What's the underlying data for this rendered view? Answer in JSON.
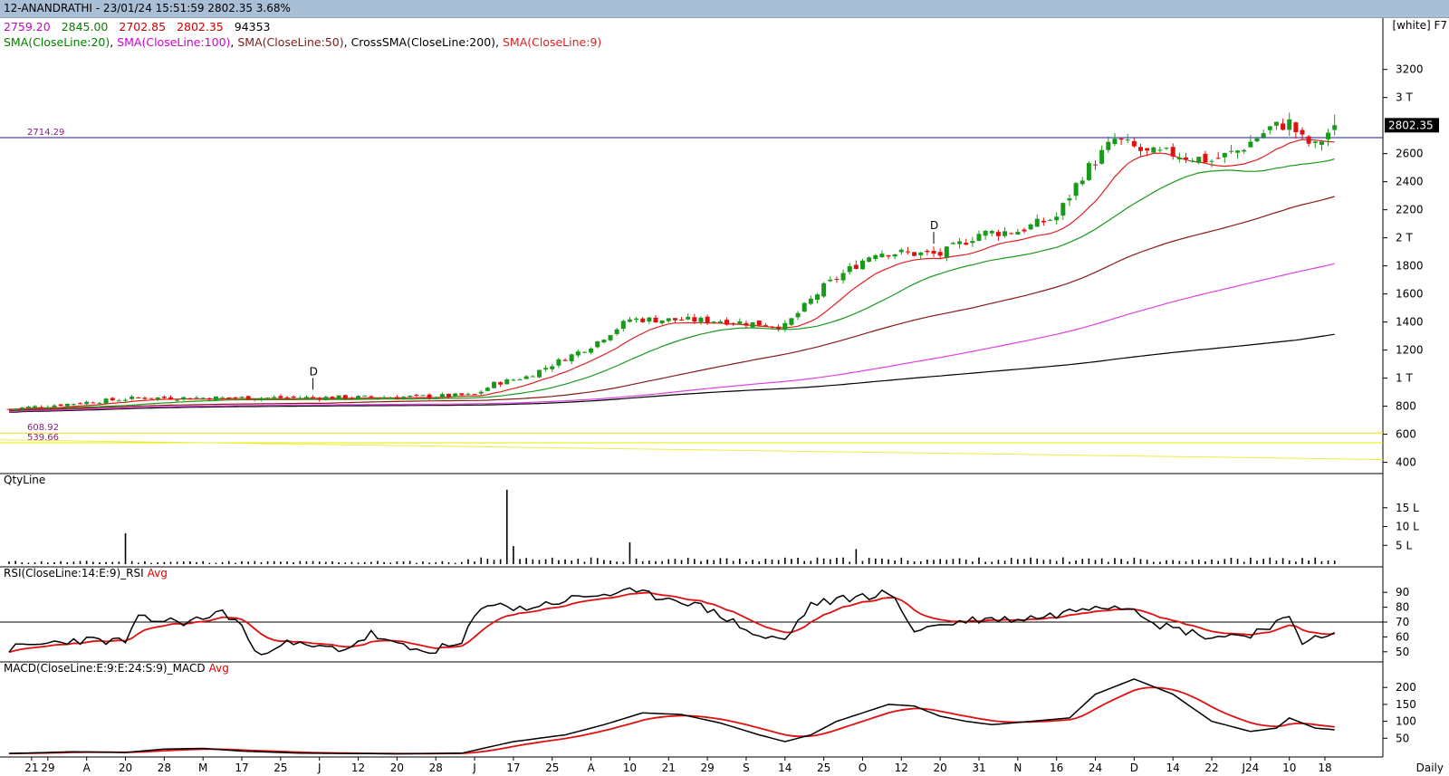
{
  "header": {
    "title": "12-ANANDRATHI - 23/01/24 15:51:59 2802.35 3.68%",
    "ohlc": [
      {
        "value": "2759.20",
        "color": "#cc00cc"
      },
      {
        "value": "2845.00",
        "color": "#008000"
      },
      {
        "value": "2702.85",
        "color": "#cc0000"
      },
      {
        "value": "2802.35",
        "color": "#cc0000"
      },
      {
        "value": "94353",
        "color": "#000000"
      }
    ],
    "indicators": [
      {
        "label": "SMA(CloseLine:20)",
        "color": "#008000"
      },
      {
        "label": "SMA(CloseLine:100)",
        "color": "#cc00cc"
      },
      {
        "label": "SMA(CloseLine:50)",
        "color": "#7a1a1a"
      },
      {
        "label": "CrossSMA(CloseLine:200)",
        "color": "#000000"
      },
      {
        "label": "SMA(CloseLine:9)",
        "color": "#e02020"
      }
    ],
    "theme": "[white] F7"
  },
  "panels": {
    "volume_title": "QtyLine",
    "rsi_title": "RSI(CloseLine:14:E:9)_RSI",
    "rsi_avg": "Avg",
    "macd_title": "MACD(CloseLine:E:9:E:24:S:9)_MACD",
    "macd_avg": "Avg",
    "period": "Daily"
  },
  "chart_data": [
    {
      "type": "candlestick",
      "symbol": "12-ANANDRATHI",
      "last_price": "2802.35",
      "price_ticks": [
        "3200",
        "3 T",
        "2600",
        "2400",
        "2200",
        "2 T",
        "1800",
        "1600",
        "1400",
        "1200",
        "1 T",
        "800",
        "600",
        "400"
      ],
      "price_tick_values": [
        3200,
        3000,
        2600,
        2400,
        2200,
        2000,
        1800,
        1600,
        1400,
        1200,
        1000,
        800,
        600,
        400
      ],
      "ylim": [
        320,
        3340
      ],
      "horizontal_lines": [
        {
          "label": "2714.29",
          "value": 2714.29,
          "color": "#1a1aa0"
        },
        {
          "label": "608.92",
          "value": 608.92,
          "color": "#e8e800"
        },
        {
          "label": "539.66",
          "value": 539.66,
          "color": "#e8e800"
        }
      ],
      "dividend_markers": [
        {
          "label": "D",
          "x_label": "25"
        },
        {
          "label": "D",
          "x_label": "20"
        }
      ],
      "x_labels": [
        "21",
        "29",
        "A",
        "20",
        "28",
        "M",
        "17",
        "25",
        "J",
        "12",
        "20",
        "28",
        "J",
        "17",
        "25",
        "A",
        "10",
        "21",
        "29",
        "S",
        "14",
        "25",
        "O",
        "12",
        "20",
        "31",
        "N",
        "16",
        "24",
        "D",
        "14",
        "22",
        "J24",
        "10",
        "18"
      ],
      "x_label_positions": [
        0.4,
        6,
        12,
        18,
        24,
        30,
        36,
        42,
        48,
        54,
        60,
        66,
        72,
        78,
        84,
        90,
        96,
        102,
        108,
        114,
        120,
        126,
        132,
        138,
        144,
        150,
        156,
        162,
        168,
        174,
        180,
        186,
        192,
        198,
        203.5
      ],
      "close_anchors": [
        [
          0,
          780
        ],
        [
          20,
          860
        ],
        [
          40,
          860
        ],
        [
          60,
          865
        ],
        [
          72,
          880
        ],
        [
          75,
          960
        ],
        [
          80,
          1010
        ],
        [
          90,
          1230
        ],
        [
          96,
          1420
        ],
        [
          110,
          1410
        ],
        [
          120,
          1370
        ],
        [
          126,
          1650
        ],
        [
          132,
          1840
        ],
        [
          134,
          1900
        ],
        [
          144,
          1880
        ],
        [
          150,
          2030
        ],
        [
          156,
          2050
        ],
        [
          162,
          2150
        ],
        [
          166,
          2450
        ],
        [
          168,
          2550
        ],
        [
          171,
          2700
        ],
        [
          176,
          2600
        ],
        [
          180,
          2600
        ],
        [
          186,
          2550
        ],
        [
          190,
          2620
        ],
        [
          195,
          2780
        ],
        [
          198,
          2820
        ],
        [
          200,
          2700
        ],
        [
          202,
          2650
        ],
        [
          205,
          2802
        ]
      ],
      "volume_ticks": [
        "15 L",
        "10 L",
        "5 L"
      ],
      "rsi_ticks": [
        "90",
        "80",
        "70",
        "60",
        "50"
      ],
      "macd_ticks": [
        "200",
        "150",
        "100",
        "50"
      ]
    }
  ]
}
